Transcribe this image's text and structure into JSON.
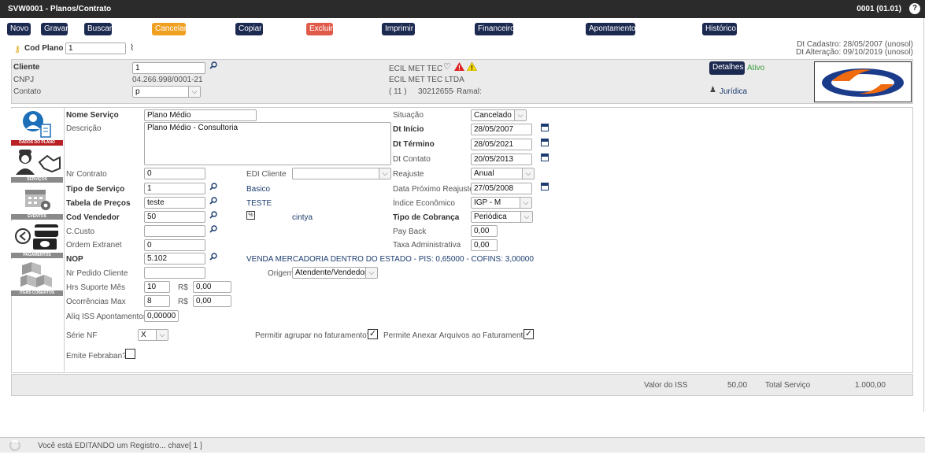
{
  "window": {
    "title": "SVW0001 - Planos/Contrato",
    "version": "0001 (01.01)",
    "help_icon": "question-icon"
  },
  "toolbar": {
    "novo": "Novo",
    "gravar": "Gravar",
    "buscar": "Buscar",
    "cancelar": "Cancelar",
    "copiar": "Copiar",
    "excluir": "Excluir",
    "imprimir": "Imprimir",
    "financeiro": "Financeiro",
    "apontamento": "Apontamento",
    "historico": "Histórico"
  },
  "header": {
    "cod_plano_label": "Cod Plano",
    "cod_plano_value": "1",
    "dt_cadastro": "Dt Cadastro: 28/05/2007 (unosol)",
    "dt_alteracao": "Dt Alteração: 09/10/2019 (unosol)"
  },
  "client": {
    "cliente_label": "Cliente",
    "cliente_value": "1",
    "cnpj_label": "CNPJ",
    "cnpj_value": "04.266.998/0001-21",
    "contato_label": "Contato",
    "contato_value": "p",
    "name": "ECIL MET TEC",
    "legal_name": "ECIL MET TEC LTDA",
    "phone_ddd": "(  11  )",
    "phone": "30212655",
    "ramal": "- Ramal:",
    "detalhes": "Detalhes",
    "status": "Ativo",
    "tipo": "Jurídica"
  },
  "sidebar": [
    {
      "caption": "DADOS DO PLANO"
    },
    {
      "caption": "SERVIÇOS"
    },
    {
      "caption": "EVENTOS"
    },
    {
      "caption": "PAGAMENTOS"
    },
    {
      "caption": "ITENS COBERTOS"
    }
  ],
  "form": {
    "nome_servico_label": "Nome Serviço",
    "nome_servico": "Plano Médio",
    "descricao_label": "Descrição",
    "descricao": "Plano Médio - Consultoria",
    "situacao_label": "Situação",
    "situacao": "Cancelado",
    "dt_inicio_label": "Dt Início",
    "dt_inicio": "28/05/2007",
    "dt_termino_label": "Dt Término",
    "dt_termino": "28/05/2021",
    "dt_contato_label": "Dt Contato",
    "dt_contato": "20/05/2013",
    "nr_contrato_label": "Nr Contrato",
    "nr_contrato": "0",
    "edi_cliente_label": "EDI Cliente",
    "edi_cliente": "",
    "reajuste_label": "Reajuste",
    "reajuste": "Anual",
    "tipo_servico_label": "Tipo de Serviço",
    "tipo_servico": "1",
    "tipo_servico_desc": "Basico",
    "data_proximo_reajuste_label": "Data Próximo Reajuste",
    "data_proximo_reajuste": "27/05/2008",
    "tabela_precos_label": "Tabela de Preços",
    "tabela_precos": "teste",
    "tabela_precos_desc": "TESTE",
    "indice_label": "Índice Econômico",
    "indice": "IGP - M",
    "cod_vendedor_label": "Cod Vendedor",
    "cod_vendedor": "50",
    "vendedor_nome": "cintya",
    "percent_icon": "%",
    "tipo_cobranca_label": "Tipo de Cobrança",
    "tipo_cobranca": "Periódica",
    "ccusto_label": "C.Custo",
    "ccusto": "",
    "payback_label": "Pay Back",
    "payback": "0,00",
    "ordem_extranet_label": "Ordem Extranet",
    "ordem_extranet": "0",
    "taxa_adm_label": "Taxa Administrativa",
    "taxa_adm": "0,00",
    "nop_label": "NOP",
    "nop": "5.102",
    "nop_desc": "VENDA MERCADORIA DENTRO DO ESTADO - PIS: 0,65000 - COFINS: 3,00000",
    "nr_pedido_label": "Nr Pedido Cliente",
    "nr_pedido": "",
    "origem_label": "Origem",
    "origem": "Atendente/Vendedor",
    "hrs_suporte_label": "Hrs Suporte Mês",
    "hrs_suporte": "10",
    "hrs_rs_label": "R$",
    "hrs_rs": "0,00",
    "ocorrencias_label": "Ocorrências Max",
    "ocorrencias": "8",
    "oco_rs_label": "R$",
    "oco_rs": "0,00",
    "aliq_iss_label": "Alíq ISS Apontamentos",
    "aliq_iss": "0,00000",
    "serie_nf_label": "Série NF",
    "serie_nf": "X",
    "permitir_agrupar_label": "Permitir agrupar no faturamento?",
    "permitir_agrupar": "✓",
    "permite_anexar_label": "Permite Anexar Arquivos ao Faturamento",
    "permite_anexar": "✓",
    "emite_febraban_label": "Emite Febraban?"
  },
  "totals": {
    "valor_iss_label": "Valor do ISS",
    "valor_iss": "50,00",
    "total_servico_label": "Total Serviço",
    "total_servico": "1.000,00"
  },
  "status_bar": {
    "message": "Você está EDITANDO um Registro... chave[ 1 ]"
  }
}
